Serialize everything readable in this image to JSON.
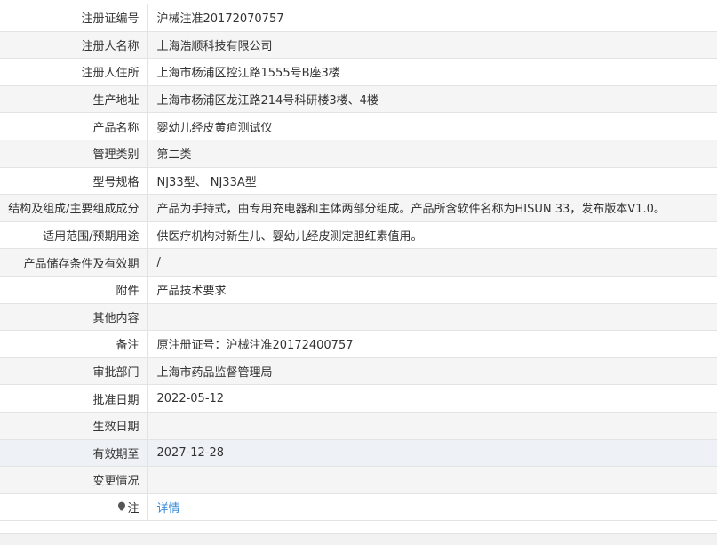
{
  "rows": [
    {
      "label": "注册证编号",
      "value": "沪械注准20172070757"
    },
    {
      "label": "注册人名称",
      "value": "上海浩顺科技有限公司"
    },
    {
      "label": "注册人住所",
      "value": "上海市杨浦区控江路1555号B座3楼"
    },
    {
      "label": "生产地址",
      "value": "上海市杨浦区龙江路214号科研楼3楼、4楼"
    },
    {
      "label": "产品名称",
      "value": "婴幼儿经皮黄疸测试仪"
    },
    {
      "label": "管理类别",
      "value": "第二类"
    },
    {
      "label": "型号规格",
      "value": "NJ33型、 NJ33A型"
    },
    {
      "label": "结构及组成/主要组成成分",
      "value": "产品为手持式，由专用充电器和主体两部分组成。产品所含软件名称为HISUN 33，发布版本V1.0。"
    },
    {
      "label": "适用范围/预期用途",
      "value": "供医疗机构对新生儿、婴幼儿经皮测定胆红素值用。"
    },
    {
      "label": "产品储存条件及有效期",
      "value": "/"
    },
    {
      "label": "附件",
      "value": "产品技术要求"
    },
    {
      "label": "其他内容",
      "value": ""
    },
    {
      "label": "备注",
      "value": "原注册证号：沪械注准20172400757"
    },
    {
      "label": "审批部门",
      "value": "上海市药品监督管理局"
    },
    {
      "label": "批准日期",
      "value": "2022-05-12"
    },
    {
      "label": "生效日期",
      "value": ""
    },
    {
      "label": "有效期至",
      "value": "2027-12-28"
    },
    {
      "label": "变更情况",
      "value": ""
    }
  ],
  "note": {
    "label": "注",
    "icon": "lightbulb-icon",
    "link_text": "详情",
    "link_color": "#3c8dd8"
  },
  "colors": {
    "border": "#e3e3e3",
    "alt_row": "#f5f5f5",
    "highlight_row": "#eef1f6"
  }
}
